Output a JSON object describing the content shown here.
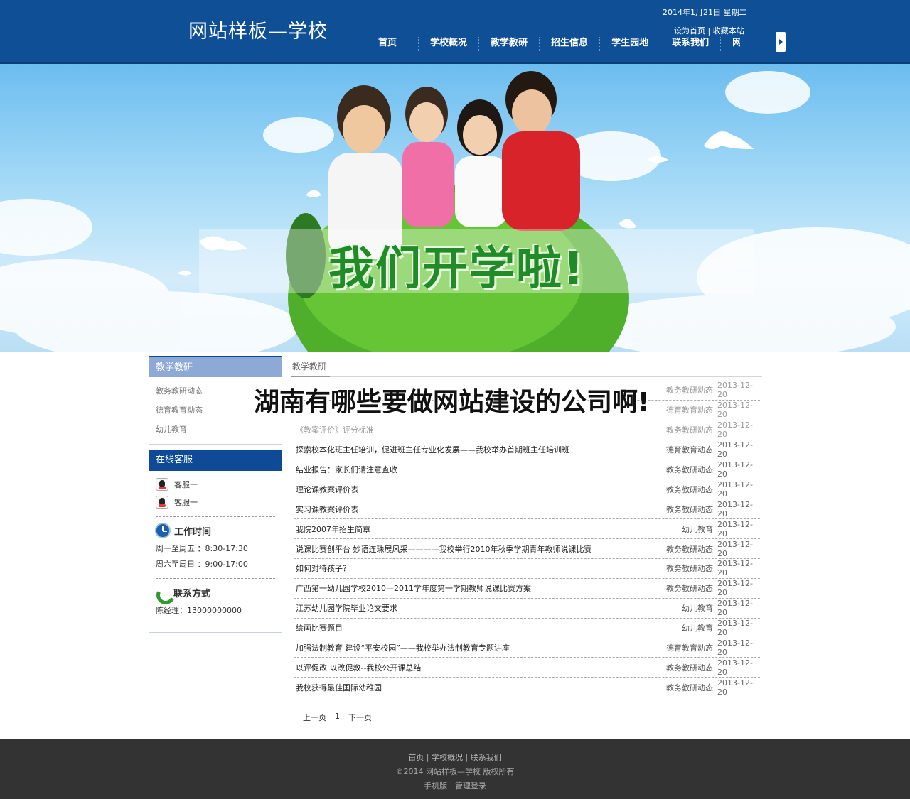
{
  "header": {
    "site_title": "网站样板—学校",
    "date": "2014年1月21日  星期二",
    "set_home": "设为首页",
    "link_sep": "|",
    "bookmark": "收藏本站",
    "nav": [
      "首页",
      "学校概况",
      "教学教研",
      "招生信息",
      "学生园地",
      "联系我们",
      "网"
    ]
  },
  "banner": {
    "slogan": "我们开学啦!"
  },
  "overlay_headline": "湖南有哪些要做网站建设的公司啊!",
  "sidebar": {
    "category_title": "教学教研",
    "categories": [
      "教务教研动态",
      "德育教育动态",
      "幼儿教育"
    ],
    "service_title": "在线客服",
    "service_agents": [
      "客服一",
      "客服一"
    ],
    "hours_title": "工作时间",
    "hours": [
      "周一至周五 ：8:30-17:30",
      "周六至周日 ：9:00-17:00"
    ],
    "contact_title": "联系方式",
    "contact": "陈经理：13000000000"
  },
  "main": {
    "section_title": "教学教研",
    "articles": [
      {
        "title": "",
        "category": "教务教研动态",
        "date": "2013-12-20"
      },
      {
        "title": "",
        "category": "德育教育动态",
        "date": "2013-12-20"
      },
      {
        "title": "《教案评价》评分标准",
        "category": "教务教研动态",
        "date": "2013-12-20"
      },
      {
        "title": "探索校本化班主任培训，促进班主任专业化发展——我校举办首期班主任培训班",
        "category": "德育教育动态",
        "date": "2013-12-20"
      },
      {
        "title": "结业报告：家长们请注意查收",
        "category": "教务教研动态",
        "date": "2013-12-20"
      },
      {
        "title": "理论课教案评价表",
        "category": "教务教研动态",
        "date": "2013-12-20"
      },
      {
        "title": "实习课教案评价表",
        "category": "教务教研动态",
        "date": "2013-12-20"
      },
      {
        "title": "我院2007年招生简章",
        "category": "幼儿教育",
        "date": "2013-12-20"
      },
      {
        "title": "说课比赛创平台 妙语连珠展风采————我校举行2010年秋季学期青年教师说课比赛",
        "category": "教务教研动态",
        "date": "2013-12-20"
      },
      {
        "title": "如何对待孩子？",
        "category": "教务教研动态",
        "date": "2013-12-20"
      },
      {
        "title": "广西第一幼儿园学校2010—2011学年度第一学期教师说课比赛方案",
        "category": "教务教研动态",
        "date": "2013-12-20"
      },
      {
        "title": "江苏幼儿园学院毕业论文要求",
        "category": "幼儿教育",
        "date": "2013-12-20"
      },
      {
        "title": "绘画比赛题目",
        "category": "幼儿教育",
        "date": "2013-12-20"
      },
      {
        "title": "加强法制教育 建设“平安校园”——我校举办法制教育专题讲座",
        "category": "德育教育动态",
        "date": "2013-12-20"
      },
      {
        "title": "以评促改 以改促教--我校公开课总结",
        "category": "教务教研动态",
        "date": "2013-12-20"
      },
      {
        "title": "我校获得最佳国际幼稚园",
        "category": "教务教研动态",
        "date": "2013-12-20"
      }
    ],
    "pager": {
      "prev": "上一页",
      "current": "1",
      "next": "下一页"
    }
  },
  "footer": {
    "links": [
      "首页",
      "学校概况",
      "联系我们"
    ],
    "sep": "|",
    "copyright": "©2014 网站样板—学校 版权所有",
    "mobile": "手机版",
    "admin": "管理登录"
  }
}
